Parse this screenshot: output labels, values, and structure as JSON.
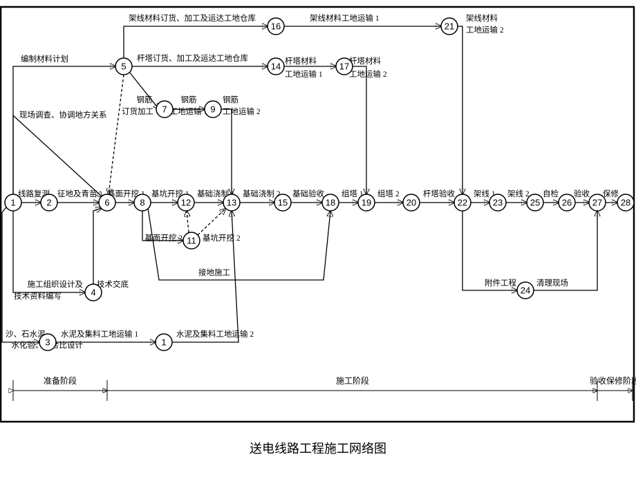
{
  "title": "送电线路工程施工网络图",
  "phases": {
    "p1": "准备阶段",
    "p2": "施工阶段",
    "p3": "验收保修阶段"
  },
  "nodes": {
    "n1": "1",
    "n2": "2",
    "n3": "3",
    "n4": "4",
    "n5": "5",
    "n6": "6",
    "n7": "7",
    "n8": "8",
    "n9": "9",
    "n10": "1",
    "n11": "11",
    "n12": "12",
    "n13": "13",
    "n14": "14",
    "n15": "15",
    "n16": "16",
    "n17": "17",
    "n18": "18",
    "n19": "19",
    "n20": "20",
    "n21": "21",
    "n22": "22",
    "n23": "23",
    "n24": "24",
    "n25": "25",
    "n26": "26",
    "n27": "27",
    "n28": "28"
  },
  "labels": {
    "e1_2": "线路复测",
    "e2_6": "征地及青苗",
    "e1_5": "编制材料计划",
    "e1_6t": "现场调查、协调地方关系",
    "e1_4a": "施工组织设计及",
    "e1_4b": "技术资料编写",
    "e4_6": "技术交底",
    "e1_3a": "沙、石水泥",
    "e1_3b": "水化验、配合比设计",
    "e3_10": "水泥及集料工地运输 1",
    "e10_13": "水泥及集料工地运输 2",
    "e5_16": "架线材料订货、加工及运达工地仓库",
    "e16_21": "架线材料工地运输 1",
    "e21a": "架线材料",
    "e21b": "工地运输 2",
    "e5_14": "杆塔订货、加工及运达工地仓库",
    "e14a": "杆塔材料",
    "e14b": "工地运输 1",
    "e17a": "杆塔材料",
    "e17b": "工地运输 2",
    "e5_7a": "钢筋",
    "e5_7b": "订货加工",
    "e7a": "钢筋",
    "e7b": "工地运输 1",
    "e9a": "钢筋",
    "e9b": "工地运输 2",
    "e6_8": "基面开挖 1",
    "e8_12": "基坑开挖 1",
    "e12_13": "基础浇制 1",
    "e13_15": "基础浇制 2",
    "e_11a": "基面开挖 2",
    "e_11b": "基坑开挖 2",
    "e15_18": "基础验收",
    "e18_19": "组塔 1",
    "e19_20": "组塔 2",
    "e20_22": "杆塔验收",
    "e22_23": "架线 1",
    "e23_25": "架线 2",
    "e25_26": "自检",
    "e26_27": "验收",
    "e27_28": "保修",
    "e8_18": "接地施工",
    "e22_24": "附件工程",
    "e24_27": "清理现场"
  },
  "chart_data": {
    "type": "network",
    "title": "送电线路工程施工网络图",
    "nodes": [
      {
        "id": 1
      },
      {
        "id": 2
      },
      {
        "id": 3
      },
      {
        "id": 4
      },
      {
        "id": 5
      },
      {
        "id": 6
      },
      {
        "id": 7
      },
      {
        "id": 8
      },
      {
        "id": 9
      },
      {
        "id": 10,
        "display": "1"
      },
      {
        "id": 11
      },
      {
        "id": 12
      },
      {
        "id": 13
      },
      {
        "id": 14
      },
      {
        "id": 15
      },
      {
        "id": 16
      },
      {
        "id": 17
      },
      {
        "id": 18
      },
      {
        "id": 19
      },
      {
        "id": 20
      },
      {
        "id": 21
      },
      {
        "id": 22
      },
      {
        "id": 23
      },
      {
        "id": 24
      },
      {
        "id": 25
      },
      {
        "id": 26
      },
      {
        "id": 27
      },
      {
        "id": 28
      }
    ],
    "edges": [
      {
        "from": 1,
        "to": 2,
        "label": "线路复测"
      },
      {
        "from": 2,
        "to": 6,
        "label": "征地及青苗"
      },
      {
        "from": 1,
        "to": 5,
        "label": "编制材料计划"
      },
      {
        "from": 1,
        "to": 6,
        "label": "现场调查、协调地方关系"
      },
      {
        "from": 1,
        "to": 4,
        "label": "施工组织设计及技术资料编写"
      },
      {
        "from": 4,
        "to": 6,
        "label": "技术交底"
      },
      {
        "from": 1,
        "to": 3,
        "label": "沙、石水泥 水化验、配合比设计"
      },
      {
        "from": 3,
        "to": 10,
        "label": "水泥及集料工地运输 1"
      },
      {
        "from": 10,
        "to": 13,
        "label": "水泥及集料工地运输 2"
      },
      {
        "from": 5,
        "to": 16,
        "label": "架线材料订货、加工及运达工地仓库"
      },
      {
        "from": 16,
        "to": 21,
        "label": "架线材料工地运输 1"
      },
      {
        "from": 21,
        "to": 22,
        "label": "架线材料工地运输 2"
      },
      {
        "from": 5,
        "to": 14,
        "label": "杆塔订货、加工及运达工地仓库"
      },
      {
        "from": 14,
        "to": 17,
        "label": "杆塔材料工地运输 1"
      },
      {
        "from": 17,
        "to": 19,
        "label": "杆塔材料工地运输 2"
      },
      {
        "from": 5,
        "to": 7,
        "label": "钢筋订货加工"
      },
      {
        "from": 7,
        "to": 9,
        "label": "钢筋工地运输 1"
      },
      {
        "from": 9,
        "to": 13,
        "label": "钢筋工地运输 2"
      },
      {
        "from": 5,
        "to": 6,
        "dummy": true
      },
      {
        "from": 6,
        "to": 8,
        "label": "基面开挖 1"
      },
      {
        "from": 8,
        "to": 12,
        "label": "基坑开挖 1"
      },
      {
        "from": 12,
        "to": 13,
        "label": "基础浇制 1"
      },
      {
        "from": 8,
        "to": 11,
        "label": "基面开挖 2"
      },
      {
        "from": 11,
        "to": 12,
        "label": "基坑开挖 2",
        "dummy": true
      },
      {
        "from": 11,
        "to": 13,
        "dummy": true
      },
      {
        "from": 13,
        "to": 15,
        "label": "基础浇制 2"
      },
      {
        "from": 15,
        "to": 18,
        "label": "基础验收"
      },
      {
        "from": 18,
        "to": 19,
        "label": "组塔 1"
      },
      {
        "from": 19,
        "to": 20,
        "label": "组塔 2"
      },
      {
        "from": 20,
        "to": 22,
        "label": "杆塔验收"
      },
      {
        "from": 22,
        "to": 23,
        "label": "架线 1"
      },
      {
        "from": 23,
        "to": 25,
        "label": "架线 2"
      },
      {
        "from": 25,
        "to": 26,
        "label": "自检"
      },
      {
        "from": 26,
        "to": 27,
        "label": "验收"
      },
      {
        "from": 27,
        "to": 28,
        "label": "保修"
      },
      {
        "from": 8,
        "to": 18,
        "label": "接地施工"
      },
      {
        "from": 22,
        "to": 24,
        "label": "附件工程"
      },
      {
        "from": 24,
        "to": 27,
        "label": "清理现场"
      }
    ],
    "phases": [
      {
        "name": "准备阶段",
        "from": 1,
        "to": 6
      },
      {
        "name": "施工阶段",
        "from": 6,
        "to": 27
      },
      {
        "name": "验收保修阶段",
        "from": 27,
        "to": 28
      }
    ]
  }
}
